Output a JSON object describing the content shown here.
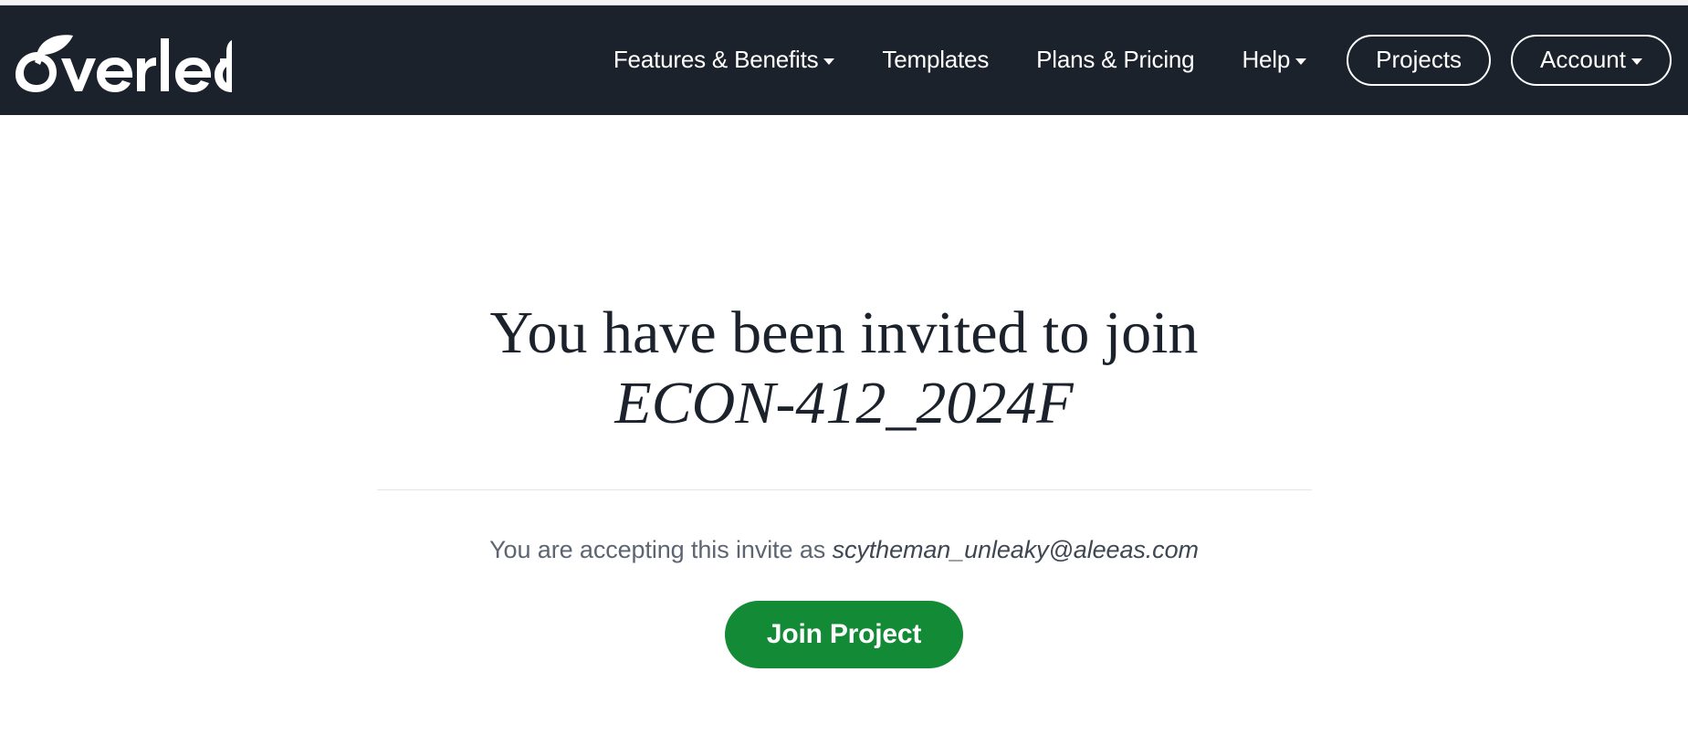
{
  "colors": {
    "navbar_bg": "#1B222C",
    "accent_green": "#138A36",
    "heading_text": "#1B222C",
    "muted_text": "#5C6571",
    "divider": "#E4E6E8"
  },
  "navbar": {
    "brand": {
      "name": "Overleaf",
      "logo_icon": "overleaf-leaf-logo",
      "wordmark": "verleaf"
    },
    "links": [
      {
        "label": "Features & Benefits",
        "has_caret": true,
        "icon": "chevron-down-icon"
      },
      {
        "label": "Templates",
        "has_caret": false,
        "icon": ""
      },
      {
        "label": "Plans & Pricing",
        "has_caret": false,
        "icon": ""
      },
      {
        "label": "Help",
        "has_caret": true,
        "icon": "chevron-down-icon"
      }
    ],
    "buttons": [
      {
        "label": "Projects",
        "has_caret": false,
        "icon": ""
      },
      {
        "label": "Account",
        "has_caret": true,
        "icon": "chevron-down-icon"
      }
    ]
  },
  "main": {
    "heading_line1": "You have been invited to join",
    "project_name": "ECON-412_2024F",
    "accept_prefix": "You are accepting this invite as",
    "accept_email": "scytheman_unleaky@aleeas.com",
    "join_button_label": "Join Project"
  }
}
